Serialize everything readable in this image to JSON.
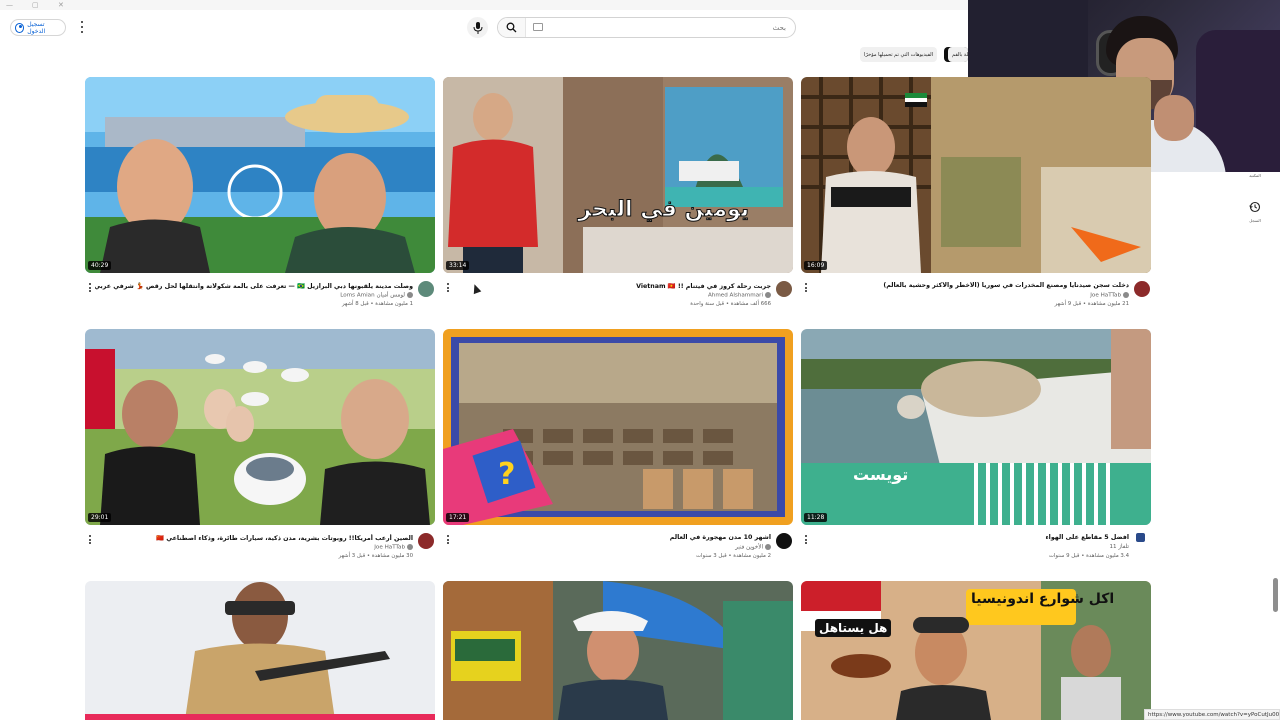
{
  "browser": {
    "window_controls": [
      "—",
      "▢",
      "✕"
    ]
  },
  "masthead": {
    "signin_label": "تسجيل الدخول",
    "search_placeholder": "بحث"
  },
  "chips": [
    "الفيديوهات التي تم تحميلها مؤخرًا",
    "جديد بالنسبة لك",
    "ذات صلة بالقم"
  ],
  "sidebar_right": [
    {
      "label": "المكتبة",
      "icon": "library-icon"
    },
    {
      "label": "السجل",
      "icon": "history-icon"
    }
  ],
  "videos": [
    {
      "title": "وصلت مدينة يلقبونها دبي البرازيل 🇧🇷 — تعرفت على بالمة شكولاتة وانتقلها لحل رقص 💃 شرفي عربي 🔥",
      "channel": "Loms Amian لومس أميان",
      "verified": true,
      "views": "1 مليون مشاهدة",
      "age": "قبل 8 أشهر",
      "duration": "40:29"
    },
    {
      "title": "جربت رحلة كروز في فيتنام !! Vietnam 🇻🇳",
      "channel": "Ahmed Alshammari",
      "verified": true,
      "views": "666 ألف مشاهدة",
      "age": "قبل سنة واحدة",
      "duration": "33:14",
      "overlay": "يومين في البحر"
    },
    {
      "title": "دخلت سجن صيدنايا ومصنع المخدرات في سوريا (الأخطر والأكثر وحشية بالعالم)",
      "channel": "Joe HaTTab",
      "verified": true,
      "views": "21 مليون مشاهدة",
      "age": "قبل 9 أشهر",
      "duration": "16:09"
    },
    {
      "title": "الصين أرعب أمريكا!! روبوتات بشرية، مدن ذكية، سيارات طائرة، وذكاء اصطناعي 🇨🇳",
      "channel": "Joe HaTTab",
      "verified": true,
      "views": "30 مليون مشاهدة",
      "age": "قبل 3 أشهر",
      "duration": "29:01"
    },
    {
      "title": "أشهر 10 مدن مهجورة في العالم",
      "channel": "الأخوين فنبر",
      "verified": true,
      "views": "2 مليون مشاهدة",
      "age": "قبل 3 سنوات",
      "duration": "17:21"
    },
    {
      "title": "أفضل 5 مقاطع على الهواء",
      "channel": "تلفاز 11",
      "verified": false,
      "views": "3.4 مليون مشاهدة",
      "age": "قبل 9 سنوات",
      "duration": "11:28",
      "overlay": "تويست"
    },
    {
      "title": "",
      "channel": "",
      "views": "",
      "age": "",
      "duration": ""
    },
    {
      "title": "",
      "channel": "",
      "views": "",
      "age": "",
      "duration": ""
    },
    {
      "title": "",
      "channel": "",
      "views": "",
      "age": "",
      "duration": "",
      "overlay": "اكل شوارع اندونيسيا",
      "overlay2": "هل يستاهل"
    }
  ],
  "status_url": "https://www.youtube.com/watch?v=yPoCutJu00k",
  "colors": {
    "accent": "#065fd4",
    "brand_red": "#ff0000",
    "thumb_bg": "#f2f2f2"
  }
}
